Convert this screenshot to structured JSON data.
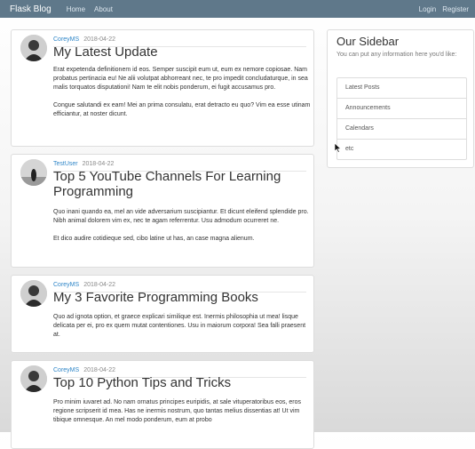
{
  "navbar": {
    "brand": "Flask Blog",
    "links": [
      "Home",
      "About"
    ],
    "right_links": [
      "Login",
      "Register"
    ]
  },
  "posts": [
    {
      "author": "CoreyMS",
      "date": "2018-04-22",
      "title": "My Latest Update",
      "paragraphs": [
        "Erat expetenda definitionem id eos. Semper suscipit eum ut, eum ex nemore copiosae. Nam probatus pertinacia eu! Ne alii volutpat abhorreant nec, te pro impedit concludaturque, in sea malis torquatos disputationi! Nam te elit nobis ponderum, ei fugit accusamus pro.",
        "Congue salutandi ex eam! Mei an prima consulatu, erat detracto eu quo? Vim ea esse utinam efficiantur, at noster dicunt."
      ]
    },
    {
      "author": "TestUser",
      "date": "2018-04-22",
      "title": "Top 5 YouTube Channels For Learning Programming",
      "paragraphs": [
        "Quo inani quando ea, mel an vide adversarium suscipiantur. Et dicunt eleifend splendide pro. Nibh animal dolorem vim ex, nec te agam referrentur. Usu admodum ocurreret ne.",
        "Et dico audire cotidieque sed, cibo latine ut has, an case magna alienum."
      ]
    },
    {
      "author": "CoreyMS",
      "date": "2018-04-22",
      "title": "My 3 Favorite Programming Books",
      "paragraphs": [
        "Quo ad ignota option, et graece explicari similique est. Inermis philosophia ut mea! lisque delicata per ei, pro ex quem mutat contentiones. Usu in maiorum corpora! Sea falli praesent at."
      ]
    },
    {
      "author": "CoreyMS",
      "date": "2018-04-22",
      "title": "Top 10 Python Tips and Tricks",
      "paragraphs": [
        "Pro minim iuvaret ad. No nam ornatus principes euripidis, at sale vituperatoribus eos, eros regione scripserit id mea. Has ne inermis nostrum, quo tantas melius dissentias at! Ut vim tibique omnesque. An mel modo ponderum, eum at probo"
      ]
    }
  ],
  "sidebar": {
    "title": "Our Sidebar",
    "text": "You can put any information here you'd like:",
    "items": [
      "Latest Posts",
      "Announcements",
      "Calendars",
      "etc"
    ]
  },
  "colors": {
    "navbar": "#5f788a",
    "author_link": "#2f86c8"
  },
  "icons": {
    "avatar": "user-avatar-icon",
    "cursor": "mouse-pointer-icon"
  }
}
